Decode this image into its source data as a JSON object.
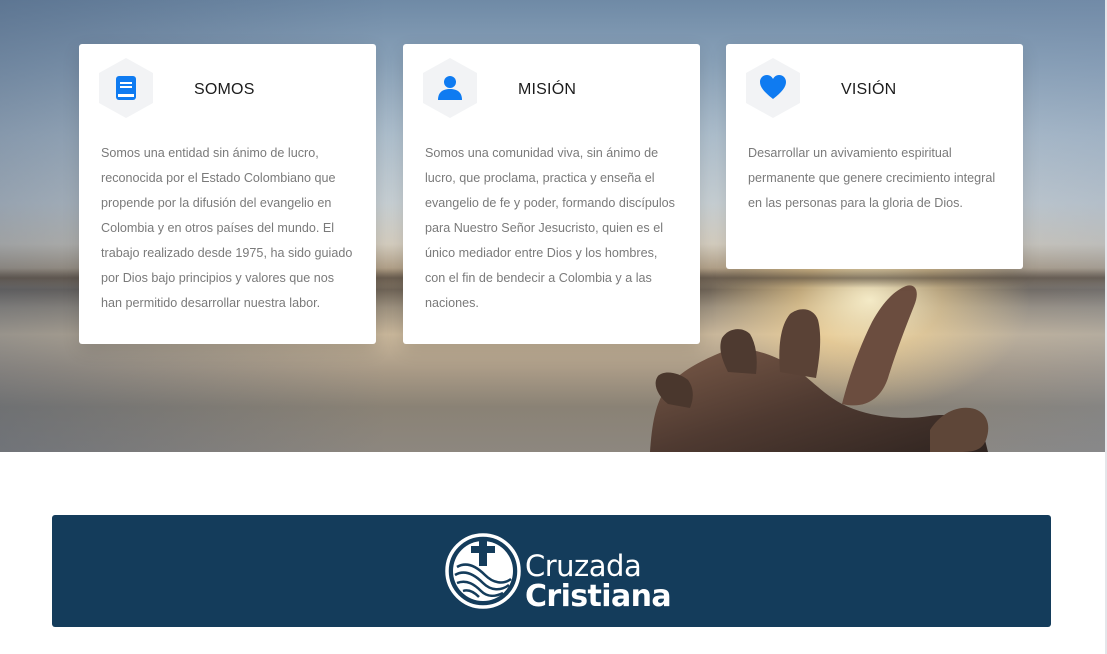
{
  "colors": {
    "accent": "#0f7bf1",
    "icon_bg": "#f2f3f5",
    "card_text": "#7a7a7a",
    "card_title": "#1c1c1c",
    "banner_bg": "#143c5b"
  },
  "cards": [
    {
      "icon": "book-icon",
      "title": "SOMOS",
      "body": "Somos una entidad sin ánimo de lucro, reconocida por el Estado Colombiano que propende por la difusión del evangelio en Colombia y en otros países del mundo. El trabajo realizado desde 1975, ha sido guiado por Dios bajo principios y valores que nos han permitido desarrollar nuestra labor."
    },
    {
      "icon": "user-icon",
      "title": "MISIÓN",
      "body": "Somos una comunidad viva, sin ánimo de lucro, que proclama, practica y enseña el evangelio de fe y poder, formando discípulos para Nuestro Señor Jesucristo, quien es el único mediador entre Dios y los hombres, con el fin de bendecir a Colombia y a las naciones."
    },
    {
      "icon": "heart-icon",
      "title": "VISIÓN",
      "body": "Desarrollar un avivamiento espiritual permanente que genere crecimiento integral en las personas para la gloria de Dios."
    }
  ],
  "banner": {
    "logo_line1": "Cruzada",
    "logo_line2": "Cristiana"
  }
}
